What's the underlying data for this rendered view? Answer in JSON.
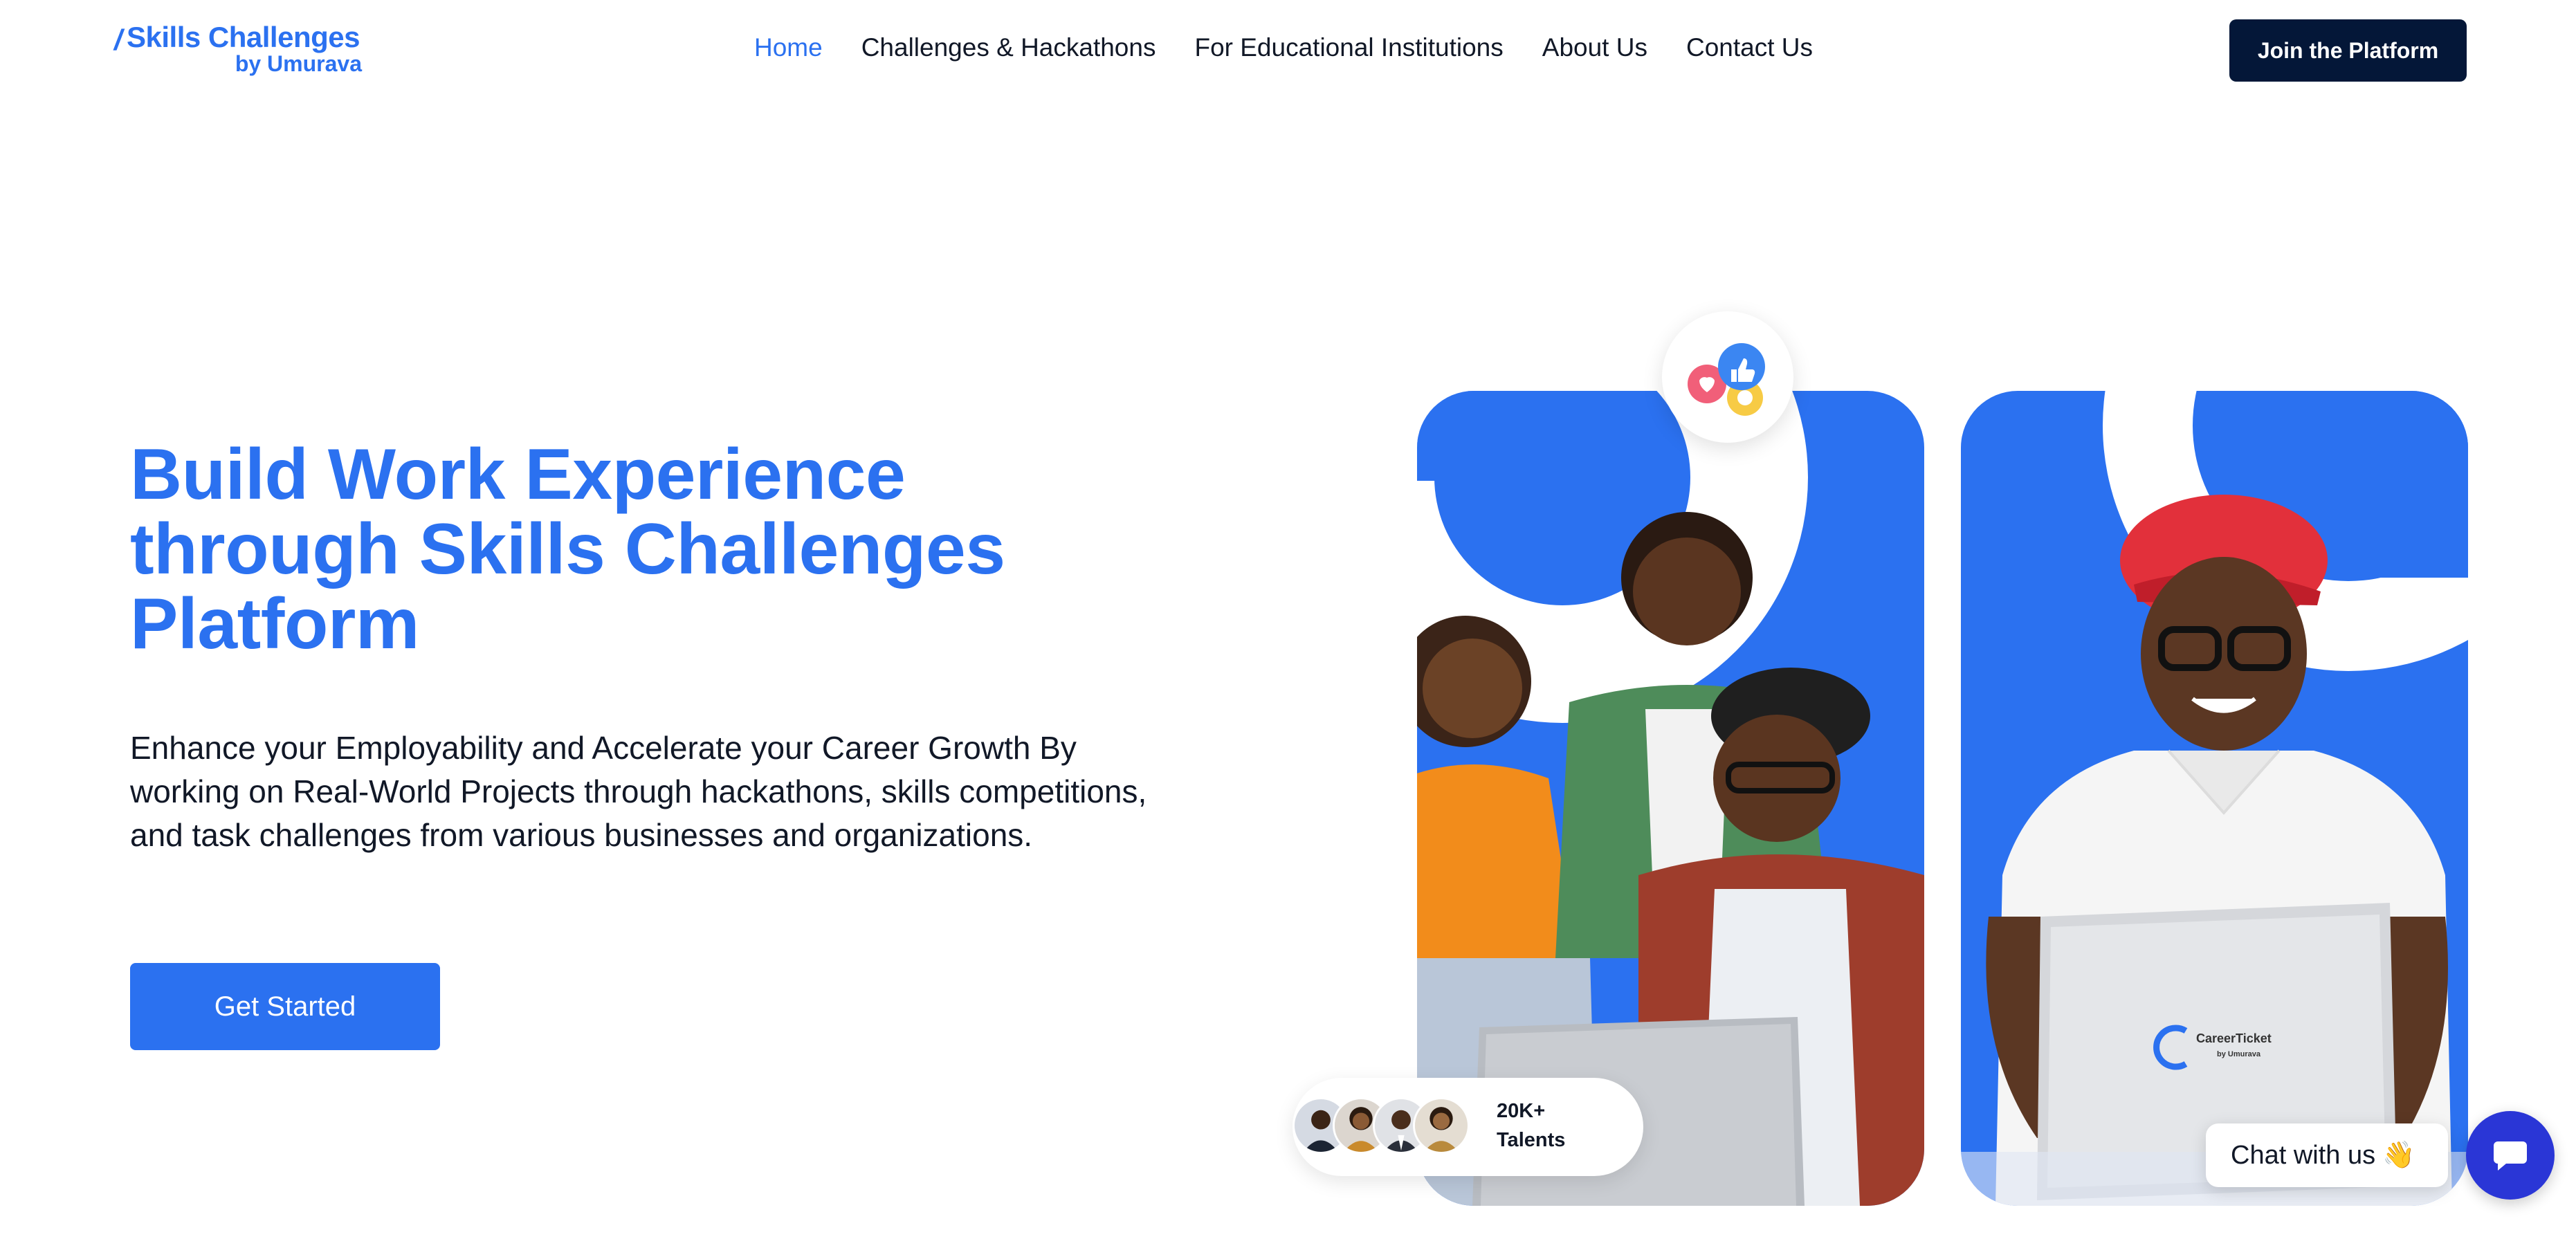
{
  "header": {
    "logo_line1": "Skills Challenges",
    "logo_line2": "by Umurava",
    "nav": [
      {
        "label": "Home",
        "active": true
      },
      {
        "label": "Challenges & Hackathons",
        "active": false
      },
      {
        "label": "For Educational Institutions",
        "active": false
      },
      {
        "label": "About Us",
        "active": false
      },
      {
        "label": "Contact Us",
        "active": false
      }
    ],
    "cta_label": "Join the Platform"
  },
  "hero": {
    "title_line1": "Build Work Experience",
    "title_line2": "through Skills Challenges",
    "title_line3": "Platform",
    "description": "Enhance your Employability and Accelerate your Career Growth By working on Real-World Projects through hackathons, skills competitions, and task challenges from various businesses and organizations.",
    "cta_label": "Get Started"
  },
  "talents": {
    "count": "20K+",
    "label": "Talents"
  },
  "laptop_brand": {
    "name": "CareerTicket",
    "sub": "by Umurava"
  },
  "chat": {
    "label": "Chat with us",
    "emoji": "👋"
  },
  "colors": {
    "brand_blue": "#2B71F0",
    "navy": "#041738",
    "chat_button": "#2A36D6"
  },
  "icons": [
    "reaction-icons",
    "chat-icon"
  ]
}
